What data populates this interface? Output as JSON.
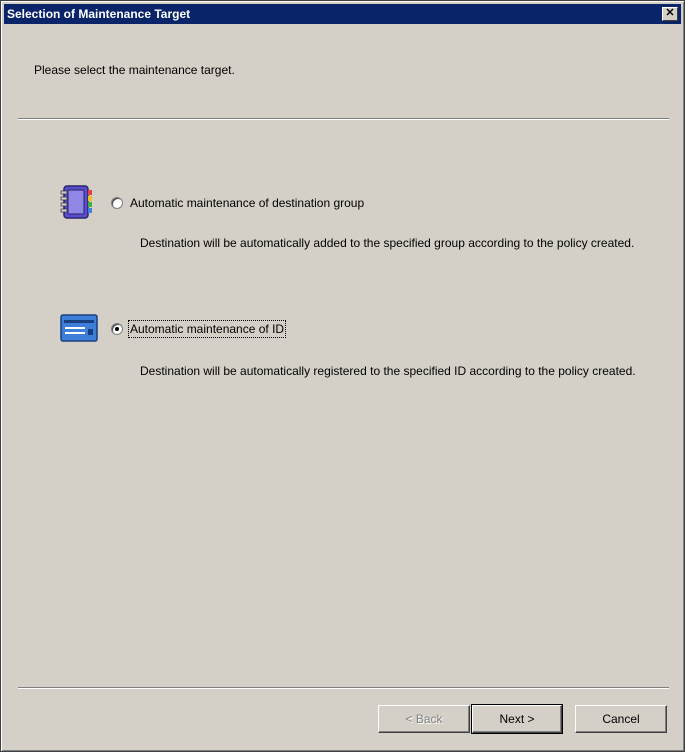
{
  "window": {
    "title": "Selection of Maintenance Target",
    "close_glyph": "✕"
  },
  "header": {
    "text": "Please select the maintenance target."
  },
  "options": [
    {
      "icon": "address-book-icon",
      "label": "Automatic maintenance of destination group",
      "description": "Destination will be automatically added to the specified group according to the policy created.",
      "selected": false
    },
    {
      "icon": "id-card-icon",
      "label": "Automatic maintenance of ID",
      "description": "Destination will be automatically registered to the specified ID according to the policy created.",
      "selected": true
    }
  ],
  "buttons": {
    "back": "< Back",
    "next": "Next >",
    "cancel": "Cancel"
  },
  "colors": {
    "titlebar": "#0a246a",
    "face": "#d4d0c8",
    "book": "#5a4fc9",
    "card": "#3d7fd8"
  }
}
